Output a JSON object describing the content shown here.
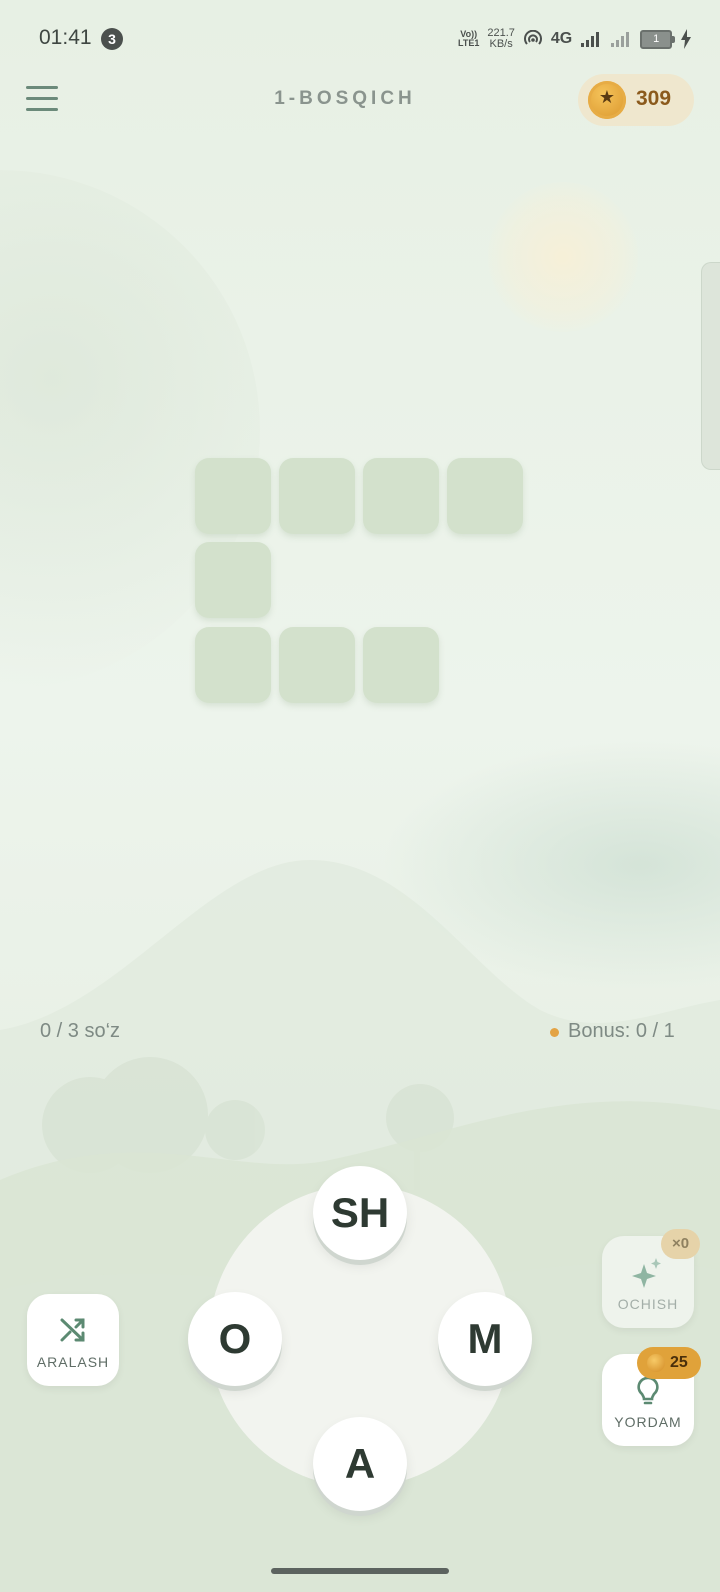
{
  "status_bar": {
    "time": "01:41",
    "notification_count": "3",
    "volte_top": "Vo))",
    "volte_bottom": "LTE1",
    "speed_value": "221.7",
    "speed_unit": "KB/s",
    "network": "4G",
    "battery": "1"
  },
  "header": {
    "title": "1-BOSQICH",
    "coins": "309",
    "coin_symbol": "★"
  },
  "progress": {
    "words": "0 / 3 so‘z",
    "bonus": "Bonus: 0 / 1"
  },
  "wheel_letters": [
    "SH",
    "O",
    "M",
    "A"
  ],
  "actions": {
    "shuffle_label": "ARALASH",
    "reveal_label": "OCHISH",
    "reveal_count": "×0",
    "hint_label": "YORDAM",
    "hint_cost": "25"
  },
  "colors": {
    "accent_green": "#5c8a72",
    "coin_gold": "#e0a23a",
    "empty_cell": "#d3e1cc"
  }
}
